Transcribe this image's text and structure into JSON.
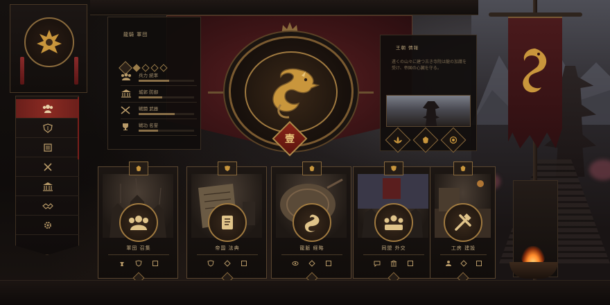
{
  "accent_gold": "#c9a45c",
  "accent_red": "#8a2a22",
  "sidebar": {
    "emblem_icon": "dragon-crest-icon",
    "items": [
      {
        "icon": "people-icon",
        "active": true
      },
      {
        "icon": "shield-icon",
        "active": false
      },
      {
        "icon": "scroll-icon",
        "active": false
      },
      {
        "icon": "crossed-swords-icon",
        "active": false
      },
      {
        "icon": "temple-icon",
        "active": false
      },
      {
        "icon": "handshake-icon",
        "active": false
      },
      {
        "icon": "gear-icon",
        "active": false
      }
    ]
  },
  "stat_panel": {
    "title": "龍騎 軍団",
    "rank_diamonds": 5,
    "rows": [
      {
        "icon": "people-icon",
        "label": "兵力 統率",
        "level": 0.55
      },
      {
        "icon": "temple-icon",
        "label": "城郭 防御",
        "level": 0.42
      },
      {
        "icon": "crossed-swords-icon",
        "label": "戦闘 武器",
        "level": 0.65
      },
      {
        "icon": "trophy-icon",
        "label": "戦功 名誉",
        "level": 0.35
      }
    ]
  },
  "medallion": {
    "icon": "dragon-icon",
    "seal_text": "壹"
  },
  "info_panel": {
    "title": "王朝 情報",
    "body": "遠くの山々に建つ古き寺院は龍の加護を受け、帝国の心臓を守る。",
    "diamond_icons": [
      "lotus-icon",
      "crest-icon",
      "orb-icon"
    ]
  },
  "cards": [
    {
      "name": "軍団 召集",
      "icon": "people-icon",
      "tab_icon": "crest-icon",
      "footer_icons": [
        "chess-icon",
        "shield-icon",
        "scroll-icon"
      ]
    },
    {
      "name": "帝国 法典",
      "icon": "scroll-icon",
      "tab_icon": "shield-icon",
      "footer_icons": [
        "shield-icon",
        "gem-icon",
        "scroll-icon"
      ]
    },
    {
      "name": "龍脈 経略",
      "icon": "dragon-icon",
      "tab_icon": "crest-icon",
      "footer_icons": [
        "eye-icon",
        "gem-icon",
        "scroll-icon"
      ]
    },
    {
      "name": "同盟 外交",
      "icon": "council-icon",
      "tab_icon": "shield-icon",
      "footer_icons": [
        "chat-icon",
        "temple-icon",
        "scroll-icon"
      ]
    },
    {
      "name": "工房 建設",
      "icon": "tools-icon",
      "tab_icon": "crest-icon",
      "footer_icons": [
        "people-icon",
        "gem-icon",
        "scroll-icon"
      ]
    }
  ]
}
